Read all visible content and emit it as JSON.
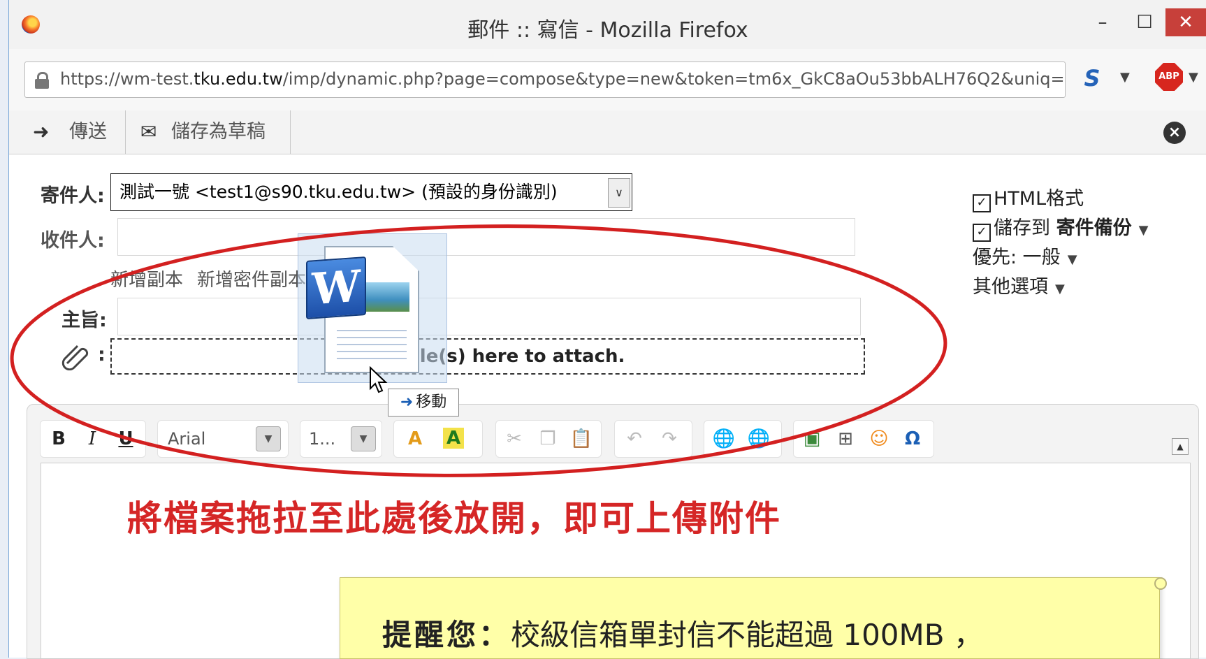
{
  "window": {
    "title": "郵件 :: 寫信 - Mozilla Firefox",
    "minimize": "–",
    "maximize": "☐",
    "close": "✕"
  },
  "address_bar": {
    "url_prefix": "https://wm-test.",
    "url_domain": "tku.edu.tw",
    "url_rest": "/imp/dynamic.php?page=compose&type=new&token=tm6x_GkC8aOu53bbALH76Q2&uniq=",
    "s_icon": "S",
    "abp_icon": "ABP"
  },
  "toolbar": {
    "send_label": "傳送",
    "draft_label": "儲存為草稿"
  },
  "form": {
    "from_label": "寄件人:",
    "from_value": "測試一號 <test1@s90.tku.edu.tw> (預設的身份識別)",
    "to_label": "收件人:",
    "to_value": "",
    "add_cc": "新增副本",
    "add_bcc": "新增密件副本",
    "subject_label": "主旨:",
    "subject_value": "",
    "attach_colon": ":",
    "drop_text": "Drop file(s) here to attach."
  },
  "options": {
    "html_format": "HTML格式",
    "html_checked": true,
    "save_to_prefix": "儲存到 ",
    "save_to_folder": "寄件備份",
    "save_checked": true,
    "priority": "優先: 一般",
    "other_options": "其他選項"
  },
  "editor": {
    "bold": "B",
    "italic": "I",
    "underline": "U",
    "font_name": "Arial",
    "font_size": "1...",
    "text_color": "A",
    "bg_color": "A"
  },
  "drag": {
    "word_letter": "W",
    "move_label": "移動"
  },
  "annotations": {
    "instruction": "將檔案拖拉至此處後放開，即可上傳附件",
    "reminder_bold": "提醒您：",
    "reminder_text": "校級信箱單封信不能超過 100MB ，",
    "ellipse_color": "#d32020"
  }
}
